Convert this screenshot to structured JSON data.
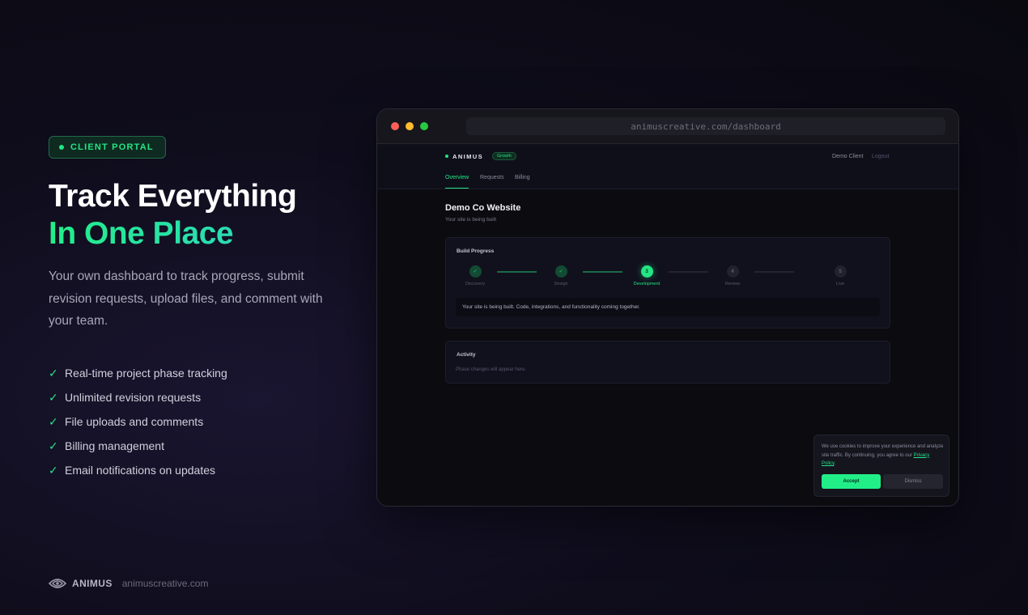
{
  "badge": {
    "label": "CLIENT PORTAL"
  },
  "headline": {
    "line1": "Track Everything",
    "line2": "In One Place"
  },
  "description": "Your own dashboard to track progress, submit revision requests, upload files, and comment with your team.",
  "features": [
    "Real-time project phase tracking",
    "Unlimited revision requests",
    "File uploads and comments",
    "Billing management",
    "Email notifications on updates"
  ],
  "footer": {
    "brand": "ANIMUS",
    "url": "animuscreative.com"
  },
  "colors": {
    "accent": "#22e584",
    "background": "#0f0d1c",
    "gradient_end": "#2fd6c4"
  },
  "browser": {
    "address": "animuscreative.com/dashboard",
    "app": {
      "logo": "ANIMUS",
      "plan_badge": "Growth",
      "client_name": "Demo Client",
      "logout_label": "Logout",
      "tabs": [
        "Overview",
        "Requests",
        "Billing"
      ],
      "active_tab": "Overview",
      "project_title": "Demo Co Website",
      "project_subtitle": "Your site is being built",
      "build_progress": {
        "title": "Build Progress",
        "steps": [
          {
            "label": "Discovery",
            "marker": "✓",
            "state": "done"
          },
          {
            "label": "Design",
            "marker": "✓",
            "state": "done"
          },
          {
            "label": "Development",
            "marker": "3",
            "state": "current"
          },
          {
            "label": "Review",
            "marker": "4",
            "state": "pending"
          },
          {
            "label": "Live",
            "marker": "5",
            "state": "pending"
          }
        ],
        "message": "Your site is being built. Code, integrations, and functionality coming together."
      },
      "activity": {
        "title": "Activity",
        "empty_text": "Phase changes will appear here."
      },
      "cookie_banner": {
        "text": "We use cookies to improve your experience and analyze site traffic. By continuing, you agree to our ",
        "link": "Privacy Policy",
        "link_suffix": ".",
        "accept_label": "Accept",
        "dismiss_label": "Dismiss"
      }
    }
  }
}
